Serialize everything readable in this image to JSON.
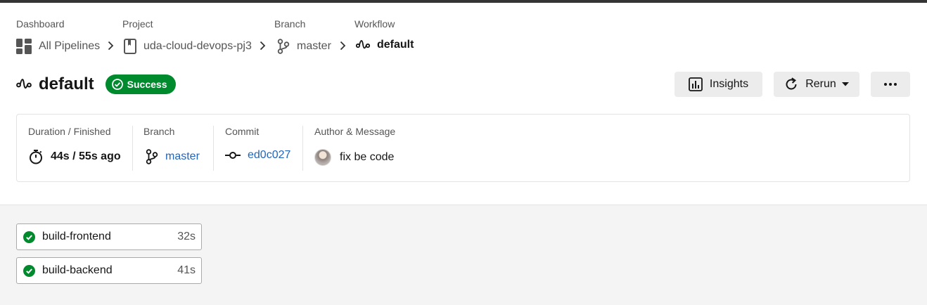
{
  "breadcrumb": {
    "items": [
      {
        "caption": "Dashboard",
        "label": "All Pipelines",
        "icon": "dashboard-grid-icon"
      },
      {
        "caption": "Project",
        "label": "uda-cloud-devops-pj3",
        "icon": "repo-icon"
      },
      {
        "caption": "Branch",
        "label": "master",
        "icon": "branch-icon"
      },
      {
        "caption": "Workflow",
        "label": "default",
        "icon": "workflow-icon"
      }
    ]
  },
  "header": {
    "title": "default",
    "status": "Success",
    "status_color": "#008a2e"
  },
  "actions": {
    "insights_label": "Insights",
    "rerun_label": "Rerun"
  },
  "summary": {
    "duration_caption": "Duration / Finished",
    "duration_value": "44s / 55s ago",
    "branch_caption": "Branch",
    "branch_value": "master",
    "commit_caption": "Commit",
    "commit_value": "ed0c027",
    "author_caption": "Author & Message",
    "message": "fix be code",
    "link_color": "#2266bb"
  },
  "jobs": [
    {
      "name": "build-frontend",
      "duration": "32s",
      "status": "success"
    },
    {
      "name": "build-backend",
      "duration": "41s",
      "status": "success"
    }
  ]
}
